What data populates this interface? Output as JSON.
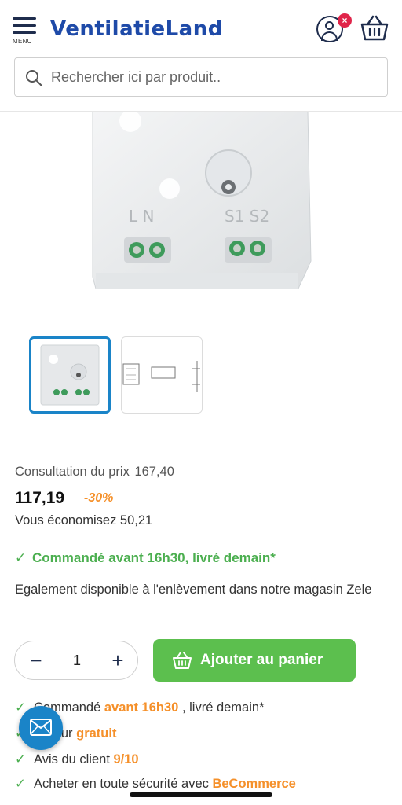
{
  "header": {
    "menu_label": "MENU",
    "logo_text": "VentilatieLand",
    "account_badge": "×",
    "brand_color": "#1e4aa8"
  },
  "search": {
    "placeholder": "Rechercher ici par produit.."
  },
  "product_image": {
    "terminal_labels_left": "L N",
    "terminal_labels_right": "S1 S2"
  },
  "pricing": {
    "consult_label": "Consultation du prix",
    "old_price": "167,40",
    "price": "117,19",
    "discount": "-30%",
    "savings": "Vous économisez 50,21"
  },
  "delivery": {
    "line": "Commandé avant 16h30, livré demain*"
  },
  "pickup": {
    "text": "Egalement disponible à l'enlèvement dans notre magasin Zele"
  },
  "quantity": {
    "minus": "−",
    "value": "1",
    "plus": "+"
  },
  "add_to_cart": {
    "label": "Ajouter au panier",
    "color": "#5cbf4e"
  },
  "usps": [
    {
      "prefix": "Commandé ",
      "accent": "avant 16h30",
      "suffix": " , livré demain*"
    },
    {
      "prefix": "Retour ",
      "accent": "gratuit",
      "suffix": ""
    },
    {
      "prefix": "Avis du client ",
      "accent": "9/10",
      "suffix": ""
    },
    {
      "prefix": "Acheter en toute sécurité avec ",
      "accent": "BeCommerce",
      "suffix": ""
    }
  ],
  "colors": {
    "accent_orange": "#f5902a",
    "success_green": "#4caf50",
    "chat_blue": "#1a84c8"
  }
}
